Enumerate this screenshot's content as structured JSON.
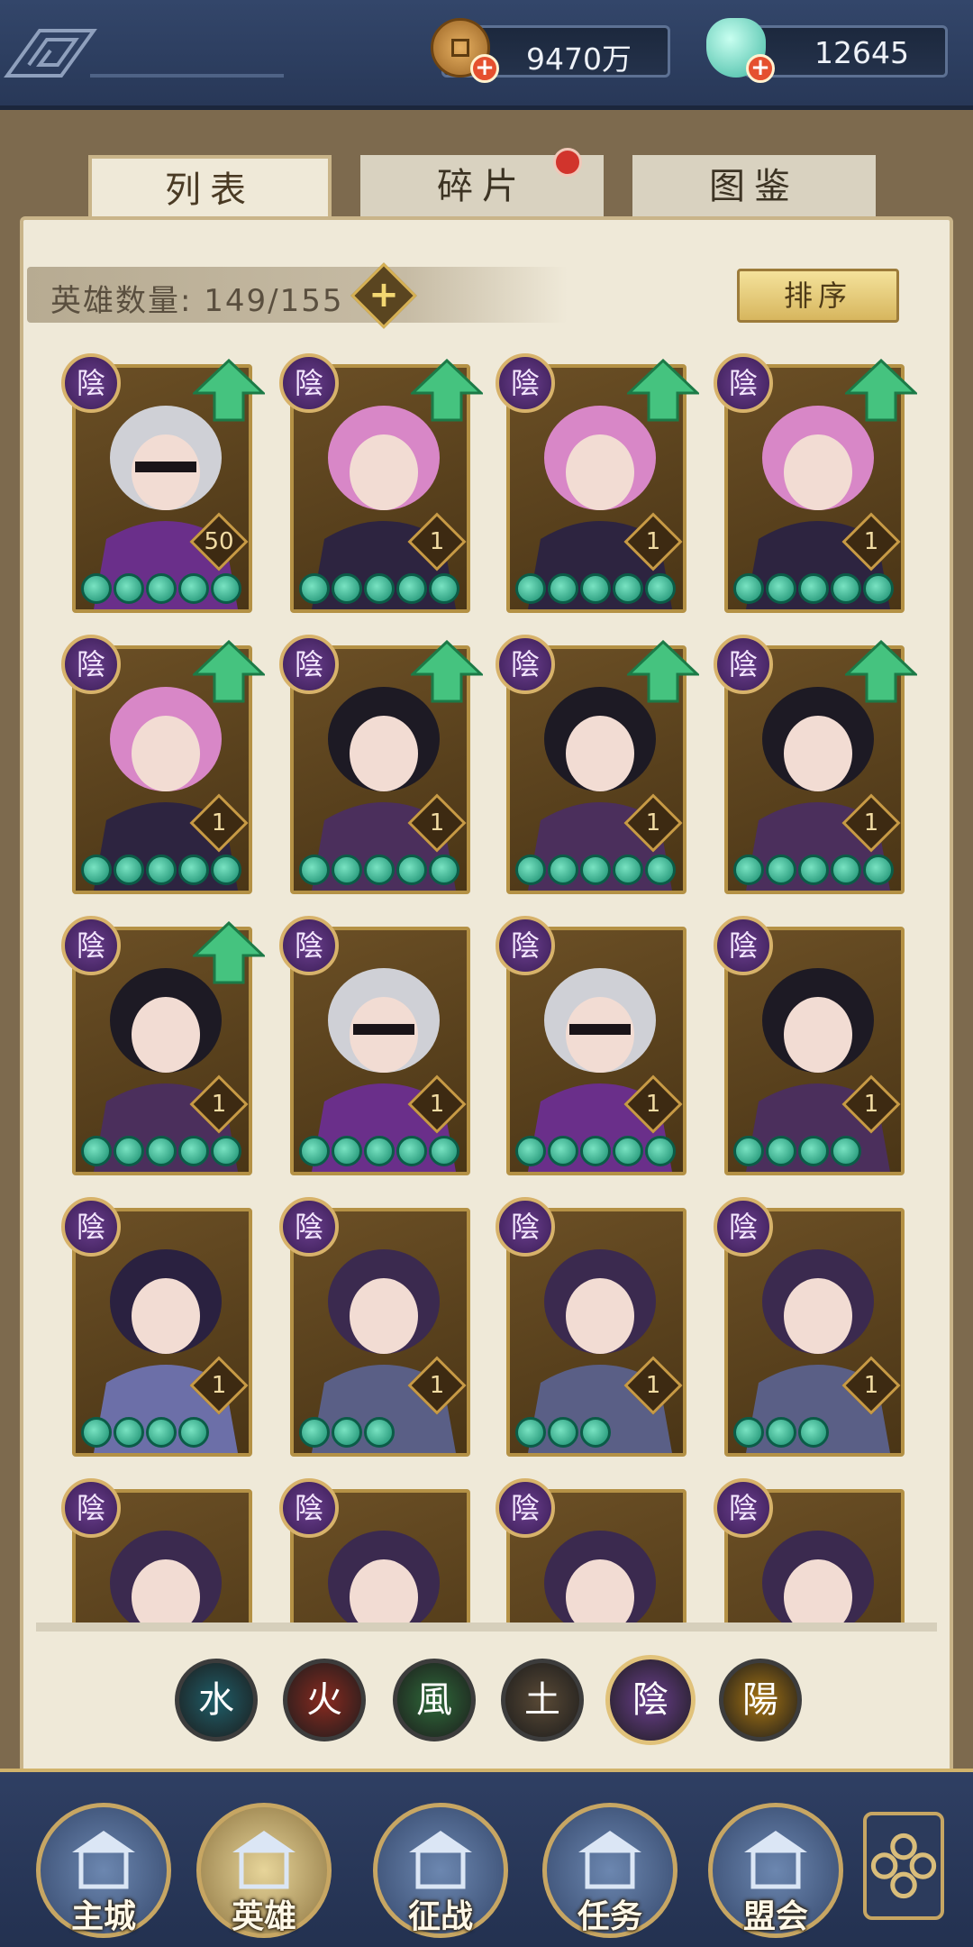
{
  "resources": {
    "coins": "9470万",
    "jade": "12645",
    "add_symbol": "+"
  },
  "tabs": [
    {
      "label": "列表",
      "active": true
    },
    {
      "label": "碎片",
      "active": false,
      "has_notification": true
    },
    {
      "label": "图鉴",
      "active": false
    }
  ],
  "hero_count": {
    "label": "英雄数量: 149/155",
    "add_symbol": "+"
  },
  "sort_button": "排序",
  "element_badge": "陰",
  "heroes": [
    {
      "level": "50",
      "stars": 5,
      "upgrade": true,
      "portrait": "silver-hair-blindfold"
    },
    {
      "level": "1",
      "stars": 5,
      "upgrade": true,
      "portrait": "pink-hair"
    },
    {
      "level": "1",
      "stars": 5,
      "upgrade": true,
      "portrait": "pink-hair"
    },
    {
      "level": "1",
      "stars": 5,
      "upgrade": true,
      "portrait": "pink-hair"
    },
    {
      "level": "1",
      "stars": 5,
      "upgrade": true,
      "portrait": "pink-hair"
    },
    {
      "level": "1",
      "stars": 5,
      "upgrade": true,
      "portrait": "black-hair-warrior"
    },
    {
      "level": "1",
      "stars": 5,
      "upgrade": true,
      "portrait": "black-hair-warrior"
    },
    {
      "level": "1",
      "stars": 5,
      "upgrade": true,
      "portrait": "black-hair-warrior"
    },
    {
      "level": "1",
      "stars": 5,
      "upgrade": true,
      "portrait": "black-hair-warrior"
    },
    {
      "level": "1",
      "stars": 5,
      "upgrade": false,
      "portrait": "silver-hair-blindfold"
    },
    {
      "level": "1",
      "stars": 5,
      "upgrade": false,
      "portrait": "silver-hair-blindfold"
    },
    {
      "level": "1",
      "stars": 4,
      "upgrade": false,
      "portrait": "black-hair-warrior"
    },
    {
      "level": "1",
      "stars": 4,
      "upgrade": false,
      "portrait": "hat-assassin"
    },
    {
      "level": "1",
      "stars": 3,
      "upgrade": false,
      "portrait": "long-purple-hair"
    },
    {
      "level": "1",
      "stars": 3,
      "upgrade": false,
      "portrait": "long-purple-hair"
    },
    {
      "level": "1",
      "stars": 3,
      "upgrade": false,
      "portrait": "long-purple-hair"
    },
    {
      "level": "",
      "stars": 0,
      "upgrade": false,
      "portrait": "long-purple-hair"
    },
    {
      "level": "",
      "stars": 0,
      "upgrade": false,
      "portrait": "long-purple-hair"
    },
    {
      "level": "",
      "stars": 0,
      "upgrade": false,
      "portrait": "long-purple-hair"
    },
    {
      "level": "",
      "stars": 0,
      "upgrade": false,
      "portrait": "long-purple-hair"
    }
  ],
  "element_filters": [
    {
      "glyph": "水",
      "name": "water",
      "color": "#1f5f6a",
      "selected": false
    },
    {
      "glyph": "火",
      "name": "fire",
      "color": "#8a2a20",
      "selected": false
    },
    {
      "glyph": "風",
      "name": "wind",
      "color": "#2f6b3a",
      "selected": false
    },
    {
      "glyph": "土",
      "name": "earth",
      "color": "#5a4a36",
      "selected": false
    },
    {
      "glyph": "陰",
      "name": "yin",
      "color": "#6b3f8e",
      "selected": true
    },
    {
      "glyph": "陽",
      "name": "yang",
      "color": "#a87512",
      "selected": false
    }
  ],
  "bottom_nav": [
    {
      "label": "主城",
      "icon": "city-icon",
      "active": false
    },
    {
      "label": "英雄",
      "icon": "hero-icon",
      "active": true
    },
    {
      "label": "征战",
      "icon": "battle-icon",
      "active": false
    },
    {
      "label": "任务",
      "icon": "quest-icon",
      "active": false
    },
    {
      "label": "盟会",
      "icon": "guild-icon",
      "active": false
    }
  ],
  "colors": {
    "top_bar": "#2b3a55",
    "panel": "#efe9d8",
    "card_border": "#b49145",
    "star": "#1fa37f",
    "upgrade_arrow": "#3fbf7a"
  }
}
